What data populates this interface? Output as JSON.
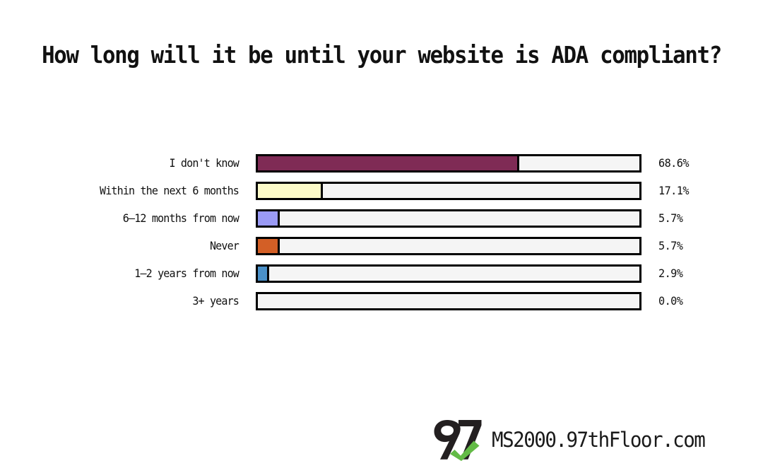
{
  "chart_data": {
    "type": "bar",
    "title": "How long will it be until your website is ADA compliant?",
    "xlabel": "",
    "ylabel": "",
    "orientation": "horizontal",
    "grid": false,
    "legend": "none",
    "xlim": [
      0,
      100
    ],
    "value_suffix": "%",
    "track_color": "#f5f5f5",
    "outline_color": "#000000",
    "categories": [
      "I don't know",
      "Within the next 6 months",
      "6–12 months from now",
      "Never",
      "1–2 years from now",
      "3+ years"
    ],
    "values": [
      68.6,
      17.1,
      5.7,
      5.7,
      2.9,
      0.0
    ],
    "value_labels": [
      "68.6%",
      "17.1%",
      "5.7%",
      "5.7%",
      "2.9%",
      "0.0%"
    ],
    "colors": [
      "#7f2b55",
      "#fcfac8",
      "#9a9af5",
      "#d35f26",
      "#4a90c8",
      "#f5f5f5"
    ],
    "bars": [
      {
        "label": "I don't know",
        "value": 68.6,
        "value_label": "68.6%",
        "color": "#7f2b55"
      },
      {
        "label": "Within the next 6 months",
        "value": 17.1,
        "value_label": "17.1%",
        "color": "#fcfac8"
      },
      {
        "label": "6–12 months from now",
        "value": 5.7,
        "value_label": "5.7%",
        "color": "#9a9af5"
      },
      {
        "label": "Never",
        "value": 5.7,
        "value_label": "5.7%",
        "color": "#d35f26"
      },
      {
        "label": "1–2 years from now",
        "value": 2.9,
        "value_label": "2.9%",
        "color": "#4a90c8"
      },
      {
        "label": "3+ years",
        "value": 0.0,
        "value_label": "0.0%",
        "color": "#f5f5f5"
      }
    ]
  },
  "footer": {
    "logo_name": "97th-floor-logo",
    "logo_mark_color": "#231f20",
    "logo_check_color": "#63bb46",
    "brand_text": "MS2000.97thFloor.com"
  }
}
